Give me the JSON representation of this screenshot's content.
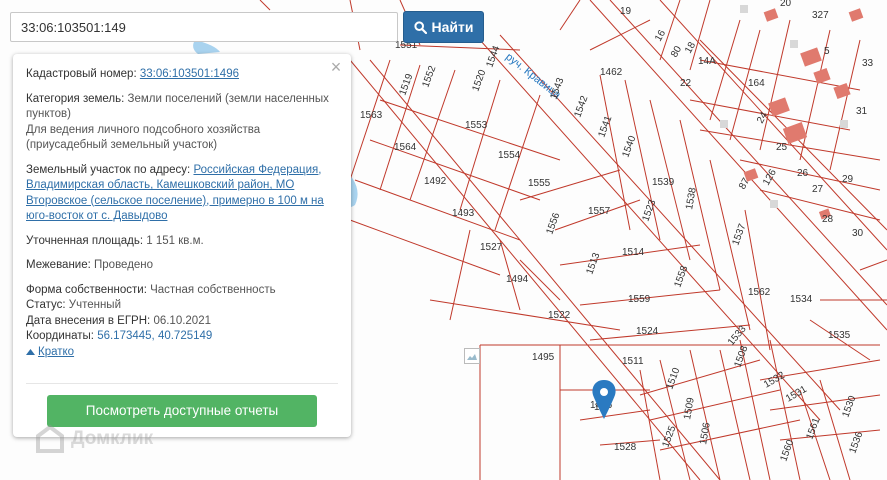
{
  "search": {
    "value": "33:06:103501:149",
    "button_label": "Найти"
  },
  "info": {
    "cadastral_label": "Кадастровый номер:",
    "cadastral_value": "33:06:103501:1496",
    "category_label": "Категория земель:",
    "category_value": "Земли поселений (земли населенных пунктов)",
    "usage_value": "Для ведения личного подсобного хозяйства (приусадебный земельный участок)",
    "address_label": "Земельный участок по адресу:",
    "address_value": "Российская Федерация, Владимирская область, Камешковский район, МО Второвское (сельское поселение), примерно в 100 м на юго-восток от с. Давыдово",
    "area_label": "Уточненная площадь:",
    "area_value": "1 151 кв.м.",
    "survey_label": "Межевание:",
    "survey_value": "Проведено",
    "ownership_label": "Форма собственности:",
    "ownership_value": "Частная собственность",
    "status_label": "Статус:",
    "status_value": "Учтенный",
    "date_label": "Дата внесения в ЕГРН:",
    "date_value": "06.10.2021",
    "coords_label": "Координаты:",
    "coords_value": "56.173445, 40.725149",
    "collapse_label": "Кратко",
    "reports_button": "Посмотреть доступные отчеты"
  },
  "map": {
    "stream_label": "руч. Кравица",
    "plot_labels": [
      "1551",
      "1552",
      "1553",
      "1554",
      "1555",
      "1556",
      "1557",
      "1558",
      "1559",
      "1560",
      "1561",
      "1562",
      "1563",
      "1564",
      "1492",
      "1493",
      "1494",
      "1495",
      "1496",
      "1506",
      "1508",
      "1509",
      "1510",
      "1511",
      "1513",
      "1514",
      "1519",
      "1520",
      "1522",
      "1523",
      "1524",
      "1525",
      "1527",
      "1528",
      "1530",
      "1531",
      "1532",
      "1533",
      "1534",
      "1535",
      "1536",
      "1537",
      "1538",
      "1539",
      "1540",
      "1541",
      "1542",
      "1543",
      "1544",
      "1462",
      "19",
      "14",
      "14А",
      "16",
      "18",
      "20",
      "22",
      "24",
      "25",
      "26",
      "27",
      "28",
      "29",
      "30",
      "31",
      "33",
      "80",
      "126",
      "164",
      "327",
      "5",
      "87"
    ],
    "watermark": "Домклик",
    "colors": {
      "line": "#c0392b",
      "building": "#e07a6e",
      "water": "#a9d3ef",
      "marker": "#2a7ac1",
      "panel_link": "#2f6fa8",
      "button_green": "#52b464",
      "search_button": "#2f6fa8"
    }
  }
}
